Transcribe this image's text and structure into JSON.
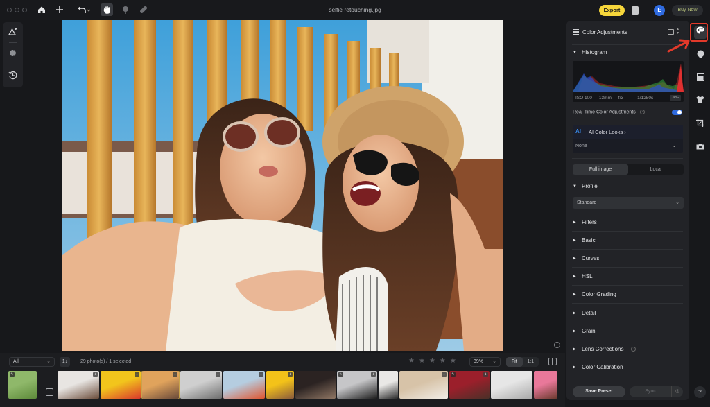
{
  "window": {
    "title": "selfie retouching.jpg"
  },
  "toolbar": {
    "home": "home-icon",
    "add": "plus-icon",
    "undo": "undo-icon",
    "tools": [
      "hand-icon",
      "tree-icon",
      "bandage-icon"
    ],
    "export_label": "Export",
    "avatar_initial": "E",
    "buy_label": "Buy Now"
  },
  "left_tools": [
    "ai-enhance-icon",
    "sun-icon",
    "history-icon"
  ],
  "filmstrip": {
    "filter_value": "All",
    "sort_label": "1↓",
    "count_text": "29 photo(s) / 1 selected",
    "rating": 0,
    "rating_max": 5,
    "zoom_value": "39%",
    "fit_label": "Fit",
    "one_to_one_label": "1:1",
    "thumbnails": [
      {
        "desc": "woman in field",
        "colors": [
          "#8fb86a",
          "#5d8a3a"
        ],
        "edited": true
      },
      {
        "desc": "man with blue eye patches",
        "colors": [
          "#e8e5e2",
          "#6b4c3a"
        ],
        "exported": true
      },
      {
        "desc": "colored pencils",
        "colors": [
          "#f2c51c",
          "#d9382c"
        ],
        "exported": true
      },
      {
        "desc": "two women selfie",
        "colors": [
          "#e0a35c",
          "#6a4a3a"
        ],
        "exported": true,
        "selected": true
      },
      {
        "desc": "bw man",
        "colors": [
          "#cfcfcf",
          "#6e6e6e"
        ],
        "exported": true
      },
      {
        "desc": "orange umbrellas",
        "colors": [
          "#b5cde0",
          "#e0552e"
        ],
        "exported": true
      },
      {
        "desc": "girl yellow bg",
        "colors": [
          "#f3c219",
          "#8a5b3c"
        ],
        "exported": true
      },
      {
        "desc": "dark portrait",
        "colors": [
          "#2b2322",
          "#8f7663"
        ]
      },
      {
        "desc": "woman black top",
        "colors": [
          "#c6c6c8",
          "#1c1c1c"
        ],
        "edited": true,
        "exported": true
      },
      {
        "desc": "gray hair woman",
        "colors": [
          "#e9e8e6",
          "#2a2a2a"
        ]
      },
      {
        "desc": "blonde woman beige",
        "colors": [
          "#d7c3a8",
          "#f1ede7"
        ],
        "exported": true
      },
      {
        "desc": "man red bg",
        "colors": [
          "#9b1f2b",
          "#4a3028"
        ],
        "edited": true,
        "exported": true
      },
      {
        "desc": "smiling woman",
        "colors": [
          "#e6e6e6",
          "#a9a9a9"
        ]
      },
      {
        "desc": "woman pink bg",
        "colors": [
          "#e9789a",
          "#6b3a2e"
        ]
      }
    ]
  },
  "panel": {
    "title": "Color Adjustments",
    "histogram": {
      "label": "Histogram",
      "iso": "ISO 100",
      "focal": "13mm",
      "aperture": "f/3",
      "shutter": "1/1250s",
      "format": "JPG"
    },
    "realtime_label": "Real-Time Color Adjustments",
    "realtime_on": true,
    "ai_looks": {
      "logo": "AI",
      "label": "AI Color Looks ›",
      "value": "None"
    },
    "scope_tabs": [
      "Full image",
      "Local"
    ],
    "scope_active": 0,
    "profile": {
      "label": "Profile",
      "value": "Standard"
    },
    "sections": [
      "Filters",
      "Basic",
      "Curves",
      "HSL",
      "Color Grading",
      "Detail",
      "Grain",
      "Lens Corrections",
      "Color Calibration"
    ],
    "save_preset_label": "Save Preset",
    "sync_label": "Sync"
  },
  "right_rail": [
    "palette-icon",
    "face-icon",
    "background-icon",
    "shirt-icon",
    "crop-icon",
    "camera-icon"
  ],
  "help_label": "?",
  "colors": {
    "accent": "#2f6be0",
    "export": "#f6d63b",
    "highlight": "#e2392a"
  }
}
